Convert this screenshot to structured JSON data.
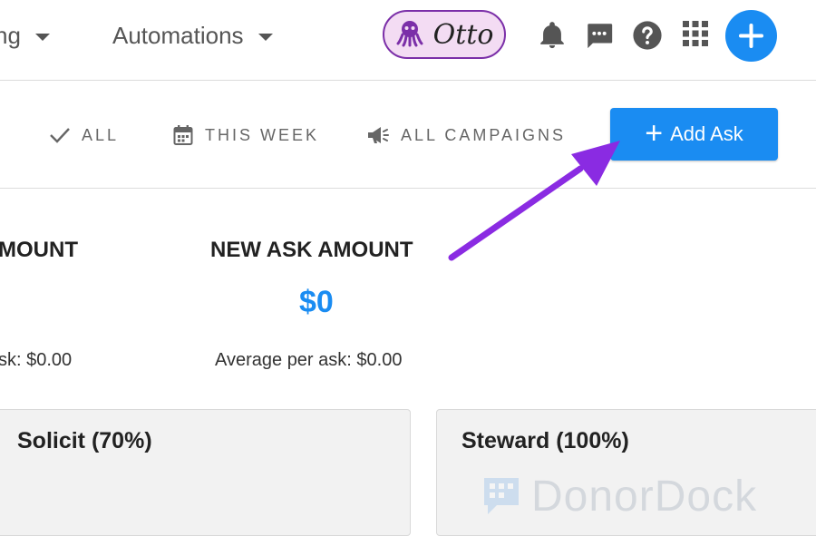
{
  "nav": {
    "partial_item_label": "ng",
    "automations_label": "Automations",
    "otto_label": "Otto",
    "icons": [
      "octopus-icon",
      "bell-icon",
      "chat-icon",
      "help-icon",
      "apps-grid-icon",
      "plus-icon"
    ]
  },
  "filters": {
    "all_label": "ALL",
    "week_label": "THIS WEEK",
    "campaigns_label": "ALL CAMPAIGNS",
    "add_ask_label": "Add Ask"
  },
  "stats": {
    "partial_title": "MOUNT",
    "partial_avg": "sk: $0.00",
    "new_ask_title": "NEW ASK AMOUNT",
    "new_ask_value": "$0",
    "new_ask_avg": "Average per ask: $0.00"
  },
  "stages": [
    {
      "label": "Solicit (70%)"
    },
    {
      "label": "Steward (100%)"
    }
  ],
  "watermark": {
    "text": "DonorDock"
  },
  "colors": {
    "accent_blue": "#1a8cf2",
    "otto_purple": "#7b2fa8",
    "otto_bg": "#f3dcf3",
    "annotation_arrow": "#8a2be2"
  }
}
